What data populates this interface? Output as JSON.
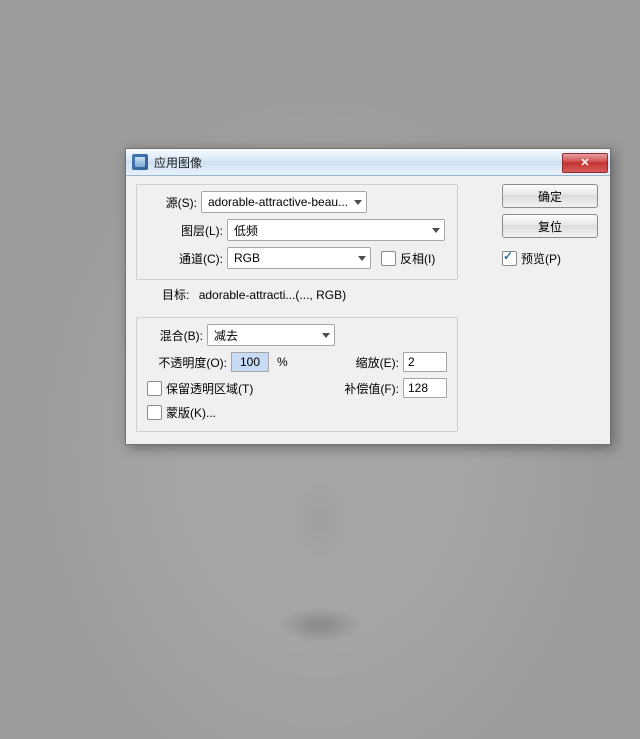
{
  "dialog": {
    "title": "应用图像",
    "source": {
      "legend": "源(S):",
      "file": "adorable-attractive-beau...",
      "layer_label": "图层(L):",
      "layer_value": "低频",
      "channel_label": "通道(C):",
      "channel_value": "RGB",
      "invert_label": "反相(I)"
    },
    "target": {
      "label": "目标:",
      "value": "adorable-attracti...(..., RGB)"
    },
    "blend": {
      "legend": "混合(B):",
      "mode": "减去",
      "opacity_label": "不透明度(O):",
      "opacity_value": "100",
      "opacity_suffix": "%",
      "preserve_label": "保留透明区域(T)",
      "mask_label": "蒙版(K)...",
      "scale_label": "缩放(E):",
      "scale_value": "2",
      "offset_label": "补偿值(F):",
      "offset_value": "128"
    },
    "buttons": {
      "ok": "确定",
      "reset": "复位",
      "preview": "预览(P)"
    }
  }
}
